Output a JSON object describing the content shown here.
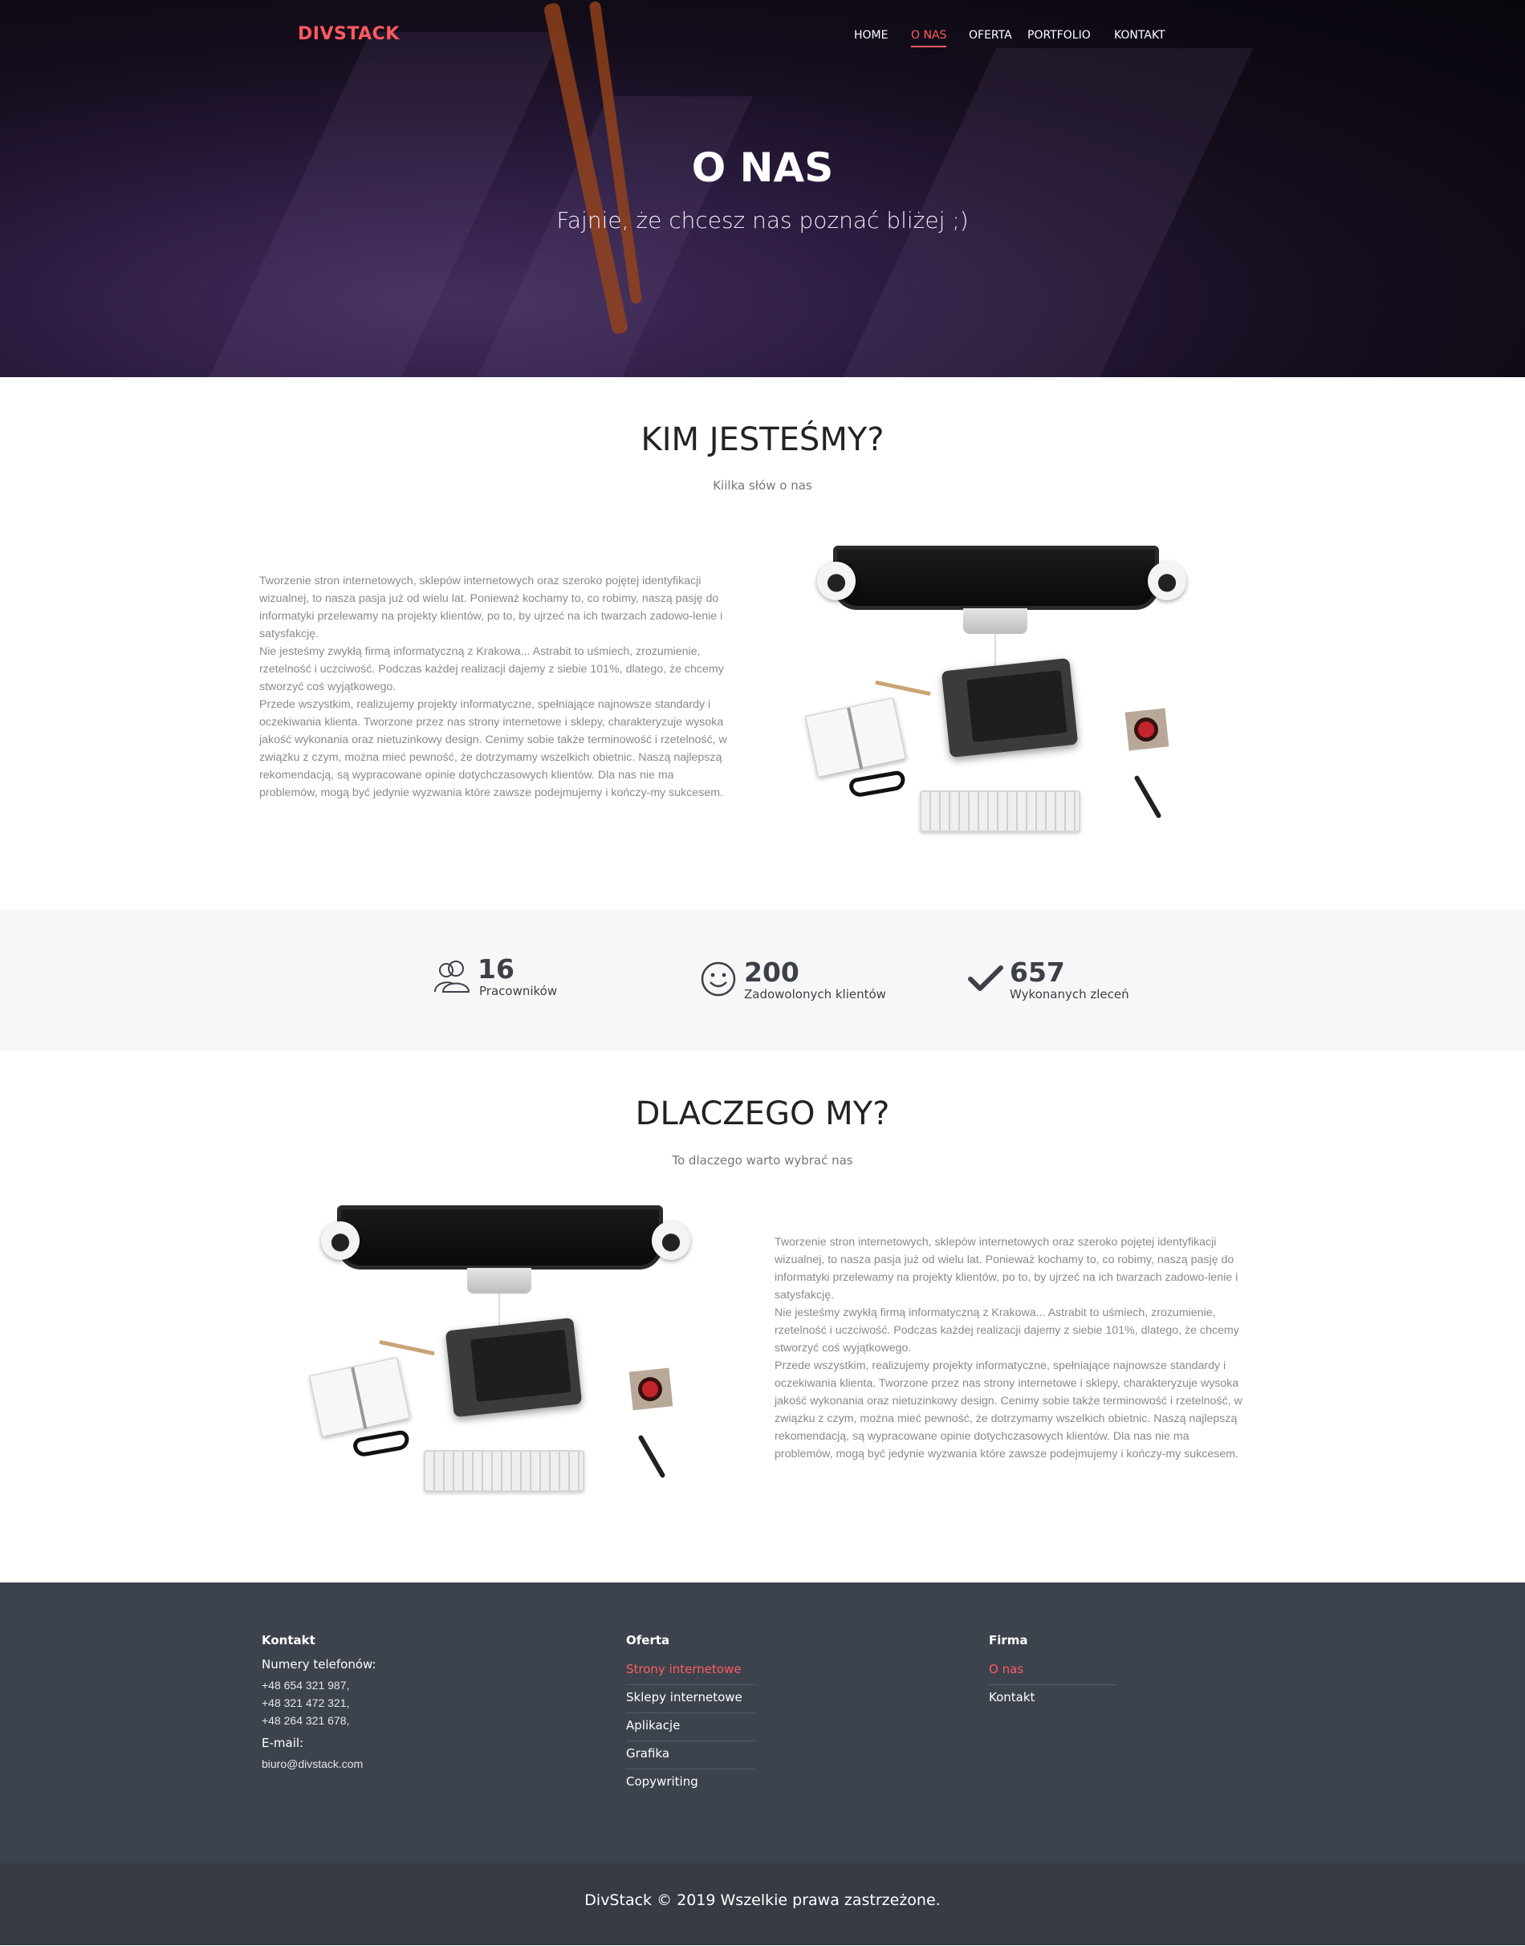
{
  "brand": "DIVSTACK",
  "nav": {
    "home": "HOME",
    "about": "O NAS",
    "offer": "OFERTA",
    "portfolio": "PORTFOLIO",
    "contact": "KONTAKT"
  },
  "hero": {
    "title": "O NAS",
    "subtitle": "Fajnie, że chcesz nas poznać bliżej ;)"
  },
  "who": {
    "title": "KIM JESTEŚMY?",
    "subtitle": "Kiilka słów o nas",
    "p1": "Tworzenie stron internetowych, sklepów internetowych oraz szeroko pojętej identyfikacji wizualnej, to nasza pasja już od wielu lat. Ponieważ kochamy to, co robimy, naszą pasję do informatyki przelewamy na projekty klientów, po to, by ujrzeć na ich twarzach zadowo-lenie i satysfakcję.",
    "p2": "Nie jesteśmy zwykłą firmą informatyczną z Krakowa... Astrabit to uśmiech, zrozumienie, rzetelność i uczciwość. Podczas każdej realizacji dajemy z siebie 101%, dlatego, że chcemy stworzyć coś wyjątkowego.",
    "p3": "Przede wszystkim, realizujemy projekty informatyczne, spełniające najnowsze standardy i oczekiwania klienta. Tworzone przez nas strony internetowe i sklepy, charakteryzuje wysoka jakość wykonania oraz nietuzinkowy design. Cenimy sobie także terminowość i rzetelność, w związku z czym, można mieć pewność, że dotrzymamy wszelkich obietnic. Naszą najlepszą rekomendacją, są wypracowane opinie dotychczasowych klientów. Dla nas nie ma problemów, mogą być jedynie wyzwania które zawsze podejmujemy i kończy-my sukcesem."
  },
  "stats": [
    {
      "icon": "users-icon",
      "number": "16",
      "label": "Pracowników"
    },
    {
      "icon": "smile-icon",
      "number": "200",
      "label": "Zadowolonych klientów"
    },
    {
      "icon": "check-icon",
      "number": "657",
      "label": "Wykonanych zleceń"
    }
  ],
  "why": {
    "title": "DLACZEGO MY?",
    "subtitle": "To dlaczego warto wybrać nas",
    "p1": "Tworzenie stron internetowych, sklepów internetowych oraz szeroko pojętej identyfikacji wizualnej, to nasza pasja już od wielu lat. Ponieważ kochamy to, co robimy, naszą pasję do informatyki przelewamy na projekty klientów, po to, by ujrzeć na ich twarzach zadowo-lenie i satysfakcję.",
    "p2": "Nie jesteśmy zwykłą firmą informatyczną z Krakowa... Astrabit to uśmiech, zrozumienie, rzetelność i uczciwość. Podczas każdej realizacji dajemy z siebie 101%, dlatego, że chcemy stworzyć coś wyjątkowego.",
    "p3": "Przede wszystkim, realizujemy projekty informatyczne, spełniające najnowsze standardy i oczekiwania klienta. Tworzone przez nas strony internetowe i sklepy, charakteryzuje wysoka jakość wykonania oraz nietuzinkowy design. Cenimy sobie także terminowość i rzetelność, w związku z czym, można mieć pewność, że dotrzymamy wszelkich obietnic. Naszą najlepszą rekomendacją, są wypracowane opinie dotychczasowych klientów. Dla nas nie ma problemów, mogą być jedynie wyzwania które zawsze podejmujemy i kończy-my sukcesem."
  },
  "footer": {
    "contact": {
      "heading": "Kontakt",
      "phones_label": "Numery telefonów:",
      "phones": [
        "+48 654 321 987,",
        "+48 321 472 321,",
        "+48 264 321 678,"
      ],
      "email_label": "E-mail:",
      "email": "biuro@divstack.com"
    },
    "offer": {
      "heading": "Oferta",
      "links": [
        "Strony internetowe",
        "Sklepy internetowe",
        "Aplikacje",
        "Grafika",
        "Copywriting"
      ]
    },
    "company": {
      "heading": "Firma",
      "links": [
        "O nas",
        "Kontakt"
      ]
    },
    "copyright": "DivStack © 2019 Wszelkie prawa zastrzeżone."
  },
  "colors": {
    "accent": "#ff5a5f",
    "footer_bg": "#3d434d",
    "bottombar_bg": "#363b44",
    "stats_bg": "#f7f7f7"
  }
}
